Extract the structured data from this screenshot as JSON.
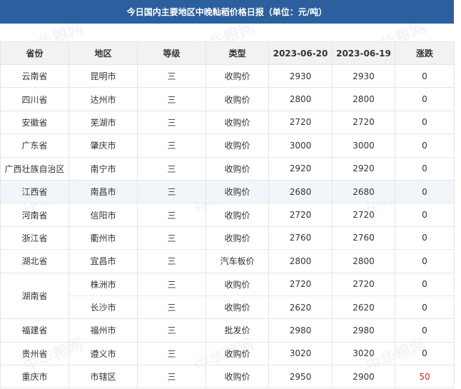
{
  "title": "今日国内主要地区中晚籼稻价格日报（单位：元/吨）",
  "watermark": "中华粮网",
  "headers": [
    "省份",
    "地区",
    "等级",
    "类型",
    "2023-06-20",
    "2023-06-19",
    "涨跌"
  ],
  "rows": [
    {
      "province": "云南省",
      "region": "昆明市",
      "grade": "三",
      "type": "收购价",
      "price_today": "2930",
      "price_prev": "2930",
      "change": "0"
    },
    {
      "province": "四川省",
      "region": "达州市",
      "grade": "三",
      "type": "收购价",
      "price_today": "2800",
      "price_prev": "2800",
      "change": "0"
    },
    {
      "province": "安徽省",
      "region": "芜湖市",
      "grade": "三",
      "type": "收购价",
      "price_today": "2720",
      "price_prev": "2720",
      "change": "0"
    },
    {
      "province": "广东省",
      "region": "肇庆市",
      "grade": "三",
      "type": "收购价",
      "price_today": "3000",
      "price_prev": "3000",
      "change": "0"
    },
    {
      "province": "广西壮族自治区",
      "region": "南宁市",
      "grade": "三",
      "type": "收购价",
      "price_today": "2920",
      "price_prev": "2920",
      "change": "0"
    },
    {
      "province": "江西省",
      "region": "南昌市",
      "grade": "三",
      "type": "收购价",
      "price_today": "2680",
      "price_prev": "2680",
      "change": "0"
    },
    {
      "province": "河南省",
      "region": "信阳市",
      "grade": "三",
      "type": "收购价",
      "price_today": "2720",
      "price_prev": "2720",
      "change": "0"
    },
    {
      "province": "浙江省",
      "region": "衢州市",
      "grade": "三",
      "type": "收购价",
      "price_today": "2760",
      "price_prev": "2760",
      "change": "0"
    },
    {
      "province": "湖北省",
      "region": "宜昌市",
      "grade": "三",
      "type": "汽车板价",
      "price_today": "2800",
      "price_prev": "2800",
      "change": "0"
    },
    {
      "province": "湖南省",
      "region": "株洲市",
      "grade": "三",
      "type": "收购价",
      "price_today": "2720",
      "price_prev": "2720",
      "change": "0"
    },
    {
      "province": "",
      "region": "长沙市",
      "grade": "三",
      "type": "收购价",
      "price_today": "2620",
      "price_prev": "2620",
      "change": "0"
    },
    {
      "province": "福建省",
      "region": "福州市",
      "grade": "三",
      "type": "批发价",
      "price_today": "2980",
      "price_prev": "2980",
      "change": "0"
    },
    {
      "province": "贵州省",
      "region": "遵义市",
      "grade": "三",
      "type": "收购价",
      "price_today": "3020",
      "price_prev": "3020",
      "change": "0"
    },
    {
      "province": "重庆市",
      "region": "市辖区",
      "grade": "三",
      "type": "收购价",
      "price_today": "2950",
      "price_prev": "2900",
      "change": "50"
    }
  ]
}
